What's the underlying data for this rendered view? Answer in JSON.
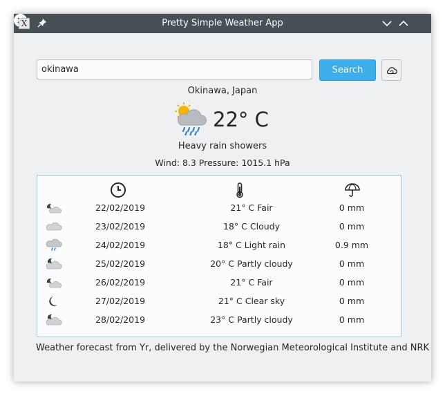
{
  "window": {
    "title": "Pretty Simple Weather App",
    "app_icon": "X"
  },
  "search": {
    "value": "okinawa",
    "button_label": "Search"
  },
  "current": {
    "location": "Okinawa, Japan",
    "temperature": "22° C",
    "condition": "Heavy rain showers",
    "details": "Wind: 8.3  Pressure: 1015.1 hPa",
    "icon": "sun-cloud-rain-icon"
  },
  "forecast": {
    "header_icons": [
      "clock-icon",
      "thermometer-icon",
      "umbrella-icon"
    ],
    "rows": [
      {
        "icon": "night-fair-icon",
        "date": "22/02/2019",
        "condition": "21° C Fair",
        "precip": "0 mm"
      },
      {
        "icon": "cloud-icon",
        "date": "23/02/2019",
        "condition": "18° C Cloudy",
        "precip": "0 mm"
      },
      {
        "icon": "light-rain-icon",
        "date": "24/02/2019",
        "condition": "18° C Light rain",
        "precip": "0.9 mm"
      },
      {
        "icon": "night-partly-cloudy-icon",
        "date": "25/02/2019",
        "condition": "20° C Partly cloudy",
        "precip": "0 mm"
      },
      {
        "icon": "night-fair-icon",
        "date": "26/02/2019",
        "condition": "21° C Fair",
        "precip": "0 mm"
      },
      {
        "icon": "moon-icon",
        "date": "27/02/2019",
        "condition": "21° C Clear sky",
        "precip": "0 mm"
      },
      {
        "icon": "night-partly-cloudy-icon",
        "date": "28/02/2019",
        "condition": "23° C Partly cloudy",
        "precip": "0 mm"
      }
    ]
  },
  "footer": {
    "text": "Weather forecast from Yr, delivered by the Norwegian Meteorological Institute and NRK"
  },
  "colors": {
    "titlebar": "#475057",
    "accent": "#3daee9",
    "window_bg": "#eff0f1",
    "forecast_border": "#94c9e6"
  }
}
